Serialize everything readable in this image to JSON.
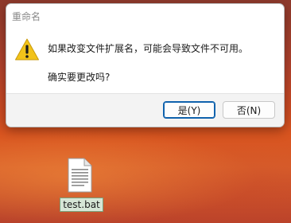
{
  "dialog": {
    "title": "重命名",
    "icon": "warning-icon",
    "message_line1": "如果改变文件扩展名，可能会导致文件不可用。",
    "message_line2": "确实要更改吗?",
    "buttons": {
      "yes_label": "是(Y)",
      "no_label": "否(N)"
    }
  },
  "desktop": {
    "file": {
      "name": "test.bat",
      "icon": "text-file-icon"
    }
  },
  "colors": {
    "accent": "#0f62ad",
    "warning": "#f2c31a",
    "desktop_background": "#cc4a23"
  }
}
